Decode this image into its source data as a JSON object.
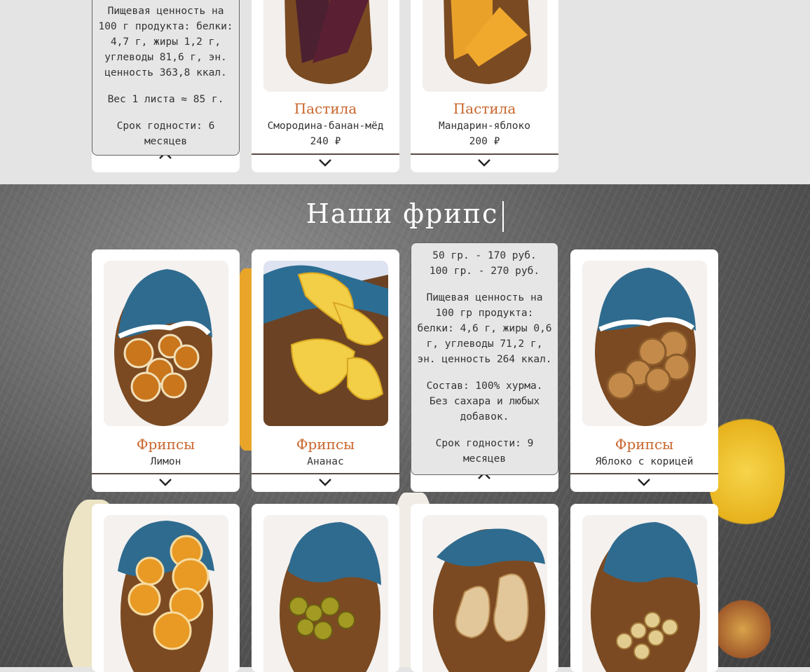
{
  "top_row": {
    "info_card": {
      "lines": [
        "Пищевая ценность на 100 г продукта: белки: 4,7 г, жиры 1,2 г, углеводы 81,6 г, эн. ценность 363,8 ккал.",
        "Вес 1 листа ≈ 85 г.",
        "Срок годности: 6 месяцев"
      ]
    },
    "products": [
      {
        "category": "Пастила",
        "name": "Смородина-банан-мёд",
        "price": "240 ₽"
      },
      {
        "category": "Пастила",
        "name": "Мандарин-яблоко",
        "price": "200 ₽"
      }
    ]
  },
  "section": {
    "title": "Наши фрипс"
  },
  "fripsy_row1": [
    {
      "category": "Фрипсы",
      "name": "Лимон"
    },
    {
      "category": "Фрипсы",
      "name": "Ананас"
    },
    {
      "category": "Фрипсы",
      "name": "Яблоко с корицей"
    }
  ],
  "info_persimmon": {
    "lines": [
      "50 гр. - 170 руб.\n100 гр. - 270 руб.",
      "Пищевая ценность на 100 гр продукта: белки: 4,6 г, жиры 0,6 г, углеводы 71,2 г, эн. ценность 264 ккал.",
      "Состав: 100% хурма. Без сахара и любых добавок.",
      "Срок годности: 9 месяцев"
    ]
  },
  "icons": {
    "expand": "chevron-down-icon",
    "collapse": "chevron-up-icon"
  },
  "colors": {
    "accent": "#c8642a",
    "page_bg": "#e4e4e4",
    "card_bg": "#ffffff",
    "info_bg": "#e6e6e6"
  }
}
